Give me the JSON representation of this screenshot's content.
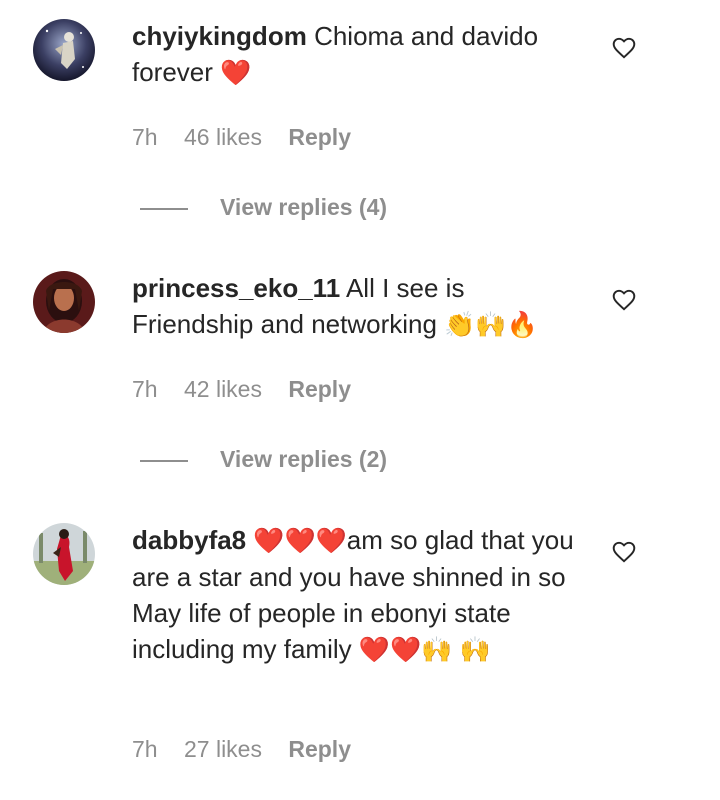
{
  "comments": [
    {
      "username": "chyiykingdom",
      "text": "Chioma and davido forever",
      "emoji_end": "❤️",
      "time": "7h",
      "likes": "46 likes",
      "reply": "Reply",
      "view_replies": "View replies (4)"
    },
    {
      "username": "princess_eko_11",
      "text": "All I see is Friendship and networking",
      "emoji_end": "👏🙌🔥",
      "time": "7h",
      "likes": "42 likes",
      "reply": "Reply",
      "view_replies": "View replies (2)"
    },
    {
      "username": "dabbyfa8",
      "emoji_mid": "❤️❤️❤️",
      "text": "am so glad that you are a star and you have shinned in so May life of people in ebonyi state including my family",
      "emoji_end": "❤️❤️🙌",
      "emoji_last": "🙌",
      "time": "7h",
      "likes": "27 likes",
      "reply": "Reply"
    }
  ],
  "colors": {
    "text": "#262626",
    "muted": "#8e8e8e",
    "heart": "#e0162b"
  }
}
